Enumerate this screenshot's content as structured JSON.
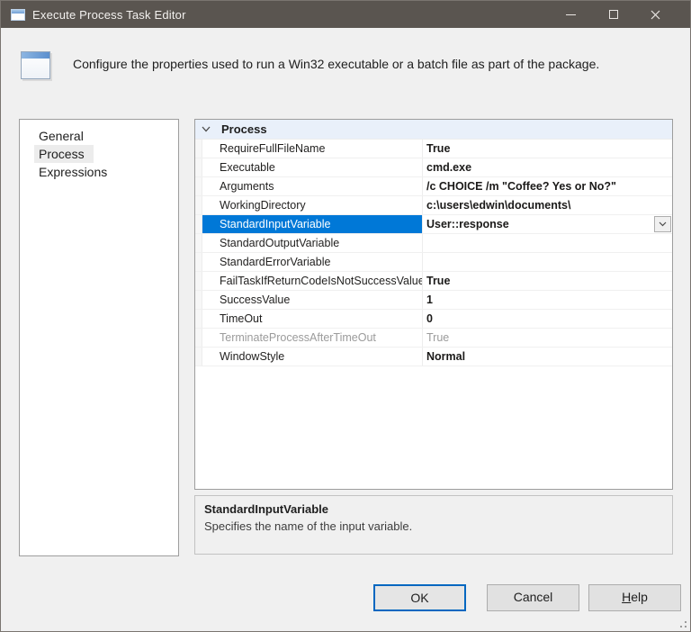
{
  "window": {
    "title": "Execute Process Task Editor",
    "controls": {
      "minimize": "minimize",
      "maximize": "maximize",
      "close": "close"
    }
  },
  "header": {
    "icon": "window-form-icon",
    "description": "Configure the properties used to run a Win32 executable or a batch file as part of the package."
  },
  "sidebar": {
    "items": [
      {
        "label": "General",
        "selected": false
      },
      {
        "label": "Process",
        "selected": true
      },
      {
        "label": "Expressions",
        "selected": false
      }
    ]
  },
  "property_grid": {
    "category": {
      "label": "Process",
      "expanded": true
    },
    "rows": [
      {
        "label": "RequireFullFileName",
        "value": "True",
        "value_bold": true,
        "selected": false,
        "disabled": false,
        "has_dropdown": false
      },
      {
        "label": "Executable",
        "value": "cmd.exe",
        "value_bold": true,
        "selected": false,
        "disabled": false,
        "has_dropdown": false
      },
      {
        "label": "Arguments",
        "value": "/c CHOICE /m \"Coffee? Yes or No?\"",
        "value_bold": true,
        "selected": false,
        "disabled": false,
        "has_dropdown": false
      },
      {
        "label": "WorkingDirectory",
        "value": "c:\\users\\edwin\\documents\\",
        "value_bold": true,
        "selected": false,
        "disabled": false,
        "has_dropdown": false
      },
      {
        "label": "StandardInputVariable",
        "value": "User::response",
        "value_bold": true,
        "selected": true,
        "disabled": false,
        "has_dropdown": true
      },
      {
        "label": "StandardOutputVariable",
        "value": "",
        "value_bold": false,
        "selected": false,
        "disabled": false,
        "has_dropdown": false
      },
      {
        "label": "StandardErrorVariable",
        "value": "",
        "value_bold": false,
        "selected": false,
        "disabled": false,
        "has_dropdown": false
      },
      {
        "label": "FailTaskIfReturnCodeIsNotSuccessValue",
        "value": "True",
        "value_bold": true,
        "selected": false,
        "disabled": false,
        "has_dropdown": false
      },
      {
        "label": "SuccessValue",
        "value": "1",
        "value_bold": true,
        "selected": false,
        "disabled": false,
        "has_dropdown": false
      },
      {
        "label": "TimeOut",
        "value": "0",
        "value_bold": true,
        "selected": false,
        "disabled": false,
        "has_dropdown": false
      },
      {
        "label": "TerminateProcessAfterTimeOut",
        "value": "True",
        "value_bold": false,
        "selected": false,
        "disabled": true,
        "has_dropdown": false
      },
      {
        "label": "WindowStyle",
        "value": "Normal",
        "value_bold": true,
        "selected": false,
        "disabled": false,
        "has_dropdown": false
      }
    ]
  },
  "description_panel": {
    "title": "StandardInputVariable",
    "text": "Specifies the name of the input variable."
  },
  "buttons": {
    "ok": "OK",
    "cancel": "Cancel",
    "help": "Help"
  },
  "colors": {
    "titlebar": "#5a5550",
    "selection_blue": "#0078d7",
    "focus_border": "#0067c0",
    "category_bg": "#e9f0fa"
  }
}
